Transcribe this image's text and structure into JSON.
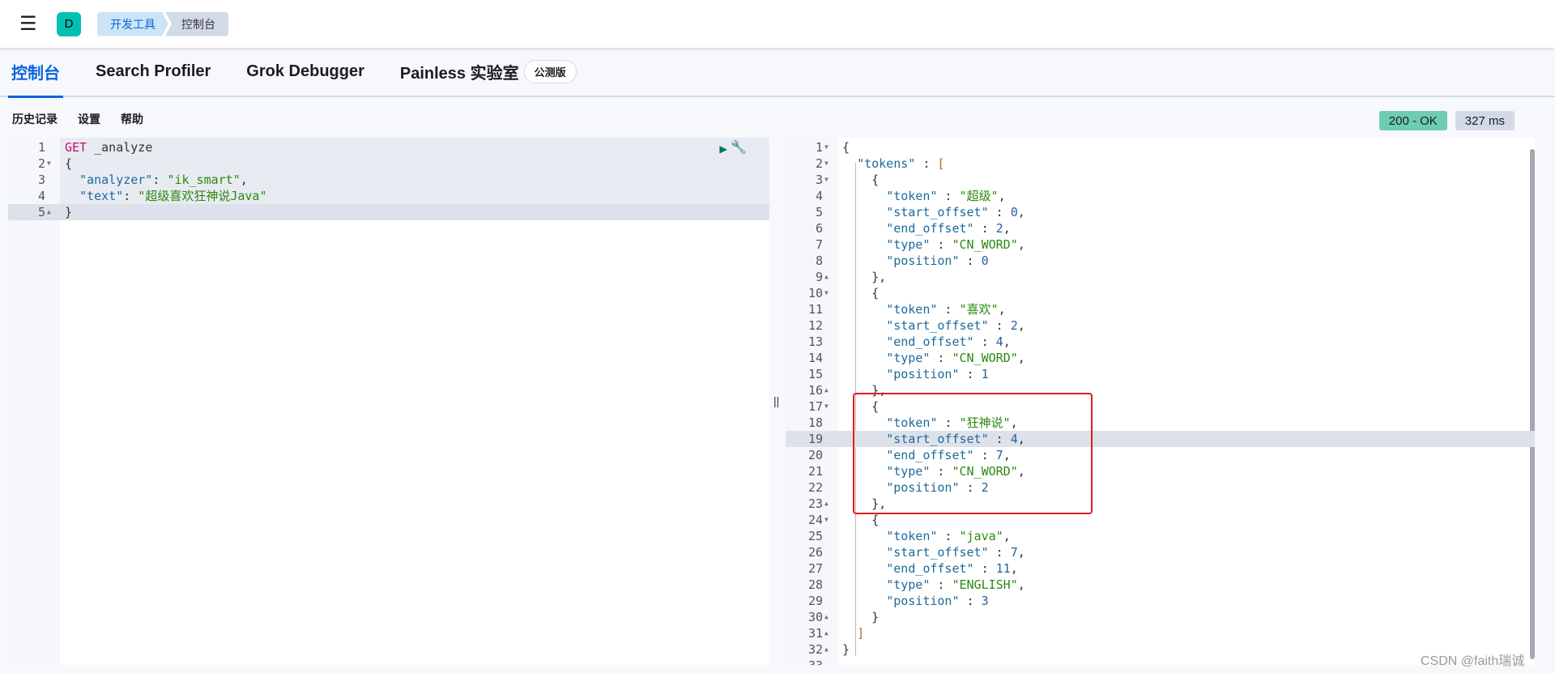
{
  "header": {
    "avatar": "D",
    "breadcrumbs": [
      "开发工具",
      "控制台"
    ]
  },
  "tabs": [
    {
      "label": "控制台",
      "active": true
    },
    {
      "label": "Search Profiler"
    },
    {
      "label": "Grok Debugger"
    },
    {
      "label": "Painless 实验室",
      "badge": "公测版"
    }
  ],
  "toolbar": {
    "history": "历史记录",
    "settings": "设置",
    "help": "帮助"
  },
  "status": {
    "code": "200 - OK",
    "time": "327 ms"
  },
  "request_lines": [
    [
      [
        "m",
        "GET"
      ],
      [
        "p",
        " _analyze"
      ]
    ],
    [
      [
        "p",
        "{"
      ]
    ],
    [
      [
        "p",
        "  "
      ],
      [
        "k",
        "\"analyzer\""
      ],
      [
        "p",
        ": "
      ],
      [
        "s",
        "\"ik_smart\""
      ],
      [
        "p",
        ","
      ]
    ],
    [
      [
        "p",
        "  "
      ],
      [
        "k",
        "\"text\""
      ],
      [
        "p",
        ": "
      ],
      [
        "s",
        "\"超级喜欢狂神说Java\""
      ]
    ],
    [
      [
        "p",
        "}"
      ]
    ]
  ],
  "response_lines": [
    [
      [
        "p",
        "{"
      ]
    ],
    [
      [
        "p",
        "  "
      ],
      [
        "k",
        "\"tokens\""
      ],
      [
        "p",
        " : "
      ],
      [
        "b",
        "["
      ]
    ],
    [
      [
        "p",
        "    {"
      ]
    ],
    [
      [
        "p",
        "      "
      ],
      [
        "k",
        "\"token\""
      ],
      [
        "p",
        " : "
      ],
      [
        "s",
        "\"超级\""
      ],
      [
        "p",
        ","
      ]
    ],
    [
      [
        "p",
        "      "
      ],
      [
        "k",
        "\"start_offset\""
      ],
      [
        "p",
        " : "
      ],
      [
        "n",
        "0"
      ],
      [
        "p",
        ","
      ]
    ],
    [
      [
        "p",
        "      "
      ],
      [
        "k",
        "\"end_offset\""
      ],
      [
        "p",
        " : "
      ],
      [
        "n",
        "2"
      ],
      [
        "p",
        ","
      ]
    ],
    [
      [
        "p",
        "      "
      ],
      [
        "k",
        "\"type\""
      ],
      [
        "p",
        " : "
      ],
      [
        "s",
        "\"CN_WORD\""
      ],
      [
        "p",
        ","
      ]
    ],
    [
      [
        "p",
        "      "
      ],
      [
        "k",
        "\"position\""
      ],
      [
        "p",
        " : "
      ],
      [
        "n",
        "0"
      ]
    ],
    [
      [
        "p",
        "    },"
      ]
    ],
    [
      [
        "p",
        "    {"
      ]
    ],
    [
      [
        "p",
        "      "
      ],
      [
        "k",
        "\"token\""
      ],
      [
        "p",
        " : "
      ],
      [
        "s",
        "\"喜欢\""
      ],
      [
        "p",
        ","
      ]
    ],
    [
      [
        "p",
        "      "
      ],
      [
        "k",
        "\"start_offset\""
      ],
      [
        "p",
        " : "
      ],
      [
        "n",
        "2"
      ],
      [
        "p",
        ","
      ]
    ],
    [
      [
        "p",
        "      "
      ],
      [
        "k",
        "\"end_offset\""
      ],
      [
        "p",
        " : "
      ],
      [
        "n",
        "4"
      ],
      [
        "p",
        ","
      ]
    ],
    [
      [
        "p",
        "      "
      ],
      [
        "k",
        "\"type\""
      ],
      [
        "p",
        " : "
      ],
      [
        "s",
        "\"CN_WORD\""
      ],
      [
        "p",
        ","
      ]
    ],
    [
      [
        "p",
        "      "
      ],
      [
        "k",
        "\"position\""
      ],
      [
        "p",
        " : "
      ],
      [
        "n",
        "1"
      ]
    ],
    [
      [
        "p",
        "    },"
      ]
    ],
    [
      [
        "p",
        "    {"
      ]
    ],
    [
      [
        "p",
        "      "
      ],
      [
        "k",
        "\"token\""
      ],
      [
        "p",
        " : "
      ],
      [
        "s",
        "\"狂神说\""
      ],
      [
        "p",
        ","
      ]
    ],
    [
      [
        "p",
        "      "
      ],
      [
        "k",
        "\"start_offset\""
      ],
      [
        "p",
        " : "
      ],
      [
        "n",
        "4"
      ],
      [
        "p",
        ","
      ]
    ],
    [
      [
        "p",
        "      "
      ],
      [
        "k",
        "\"end_offset\""
      ],
      [
        "p",
        " : "
      ],
      [
        "n",
        "7"
      ],
      [
        "p",
        ","
      ]
    ],
    [
      [
        "p",
        "      "
      ],
      [
        "k",
        "\"type\""
      ],
      [
        "p",
        " : "
      ],
      [
        "s",
        "\"CN_WORD\""
      ],
      [
        "p",
        ","
      ]
    ],
    [
      [
        "p",
        "      "
      ],
      [
        "k",
        "\"position\""
      ],
      [
        "p",
        " : "
      ],
      [
        "n",
        "2"
      ]
    ],
    [
      [
        "p",
        "    },"
      ]
    ],
    [
      [
        "p",
        "    {"
      ]
    ],
    [
      [
        "p",
        "      "
      ],
      [
        "k",
        "\"token\""
      ],
      [
        "p",
        " : "
      ],
      [
        "s",
        "\"java\""
      ],
      [
        "p",
        ","
      ]
    ],
    [
      [
        "p",
        "      "
      ],
      [
        "k",
        "\"start_offset\""
      ],
      [
        "p",
        " : "
      ],
      [
        "n",
        "7"
      ],
      [
        "p",
        ","
      ]
    ],
    [
      [
        "p",
        "      "
      ],
      [
        "k",
        "\"end_offset\""
      ],
      [
        "p",
        " : "
      ],
      [
        "n",
        "11"
      ],
      [
        "p",
        ","
      ]
    ],
    [
      [
        "p",
        "      "
      ],
      [
        "k",
        "\"type\""
      ],
      [
        "p",
        " : "
      ],
      [
        "s",
        "\"ENGLISH\""
      ],
      [
        "p",
        ","
      ]
    ],
    [
      [
        "p",
        "      "
      ],
      [
        "k",
        "\"position\""
      ],
      [
        "p",
        " : "
      ],
      [
        "n",
        "3"
      ]
    ],
    [
      [
        "p",
        "    }"
      ]
    ],
    [
      [
        "p",
        "  "
      ],
      [
        "b",
        "]"
      ]
    ],
    [
      [
        "p",
        "}"
      ]
    ],
    [
      [
        "p",
        ""
      ]
    ]
  ],
  "request_folds": {
    "2": "open",
    "5": "close"
  },
  "response_folds": {
    "1": "open",
    "2": "open",
    "3": "open",
    "9": "close",
    "10": "open",
    "16": "close",
    "17": "open",
    "23": "close",
    "24": "open",
    "30": "close",
    "31": "close",
    "32": "close"
  },
  "request_active_line": 5,
  "response_active_line": 19,
  "watermark": "CSDN @faith瑞诚"
}
